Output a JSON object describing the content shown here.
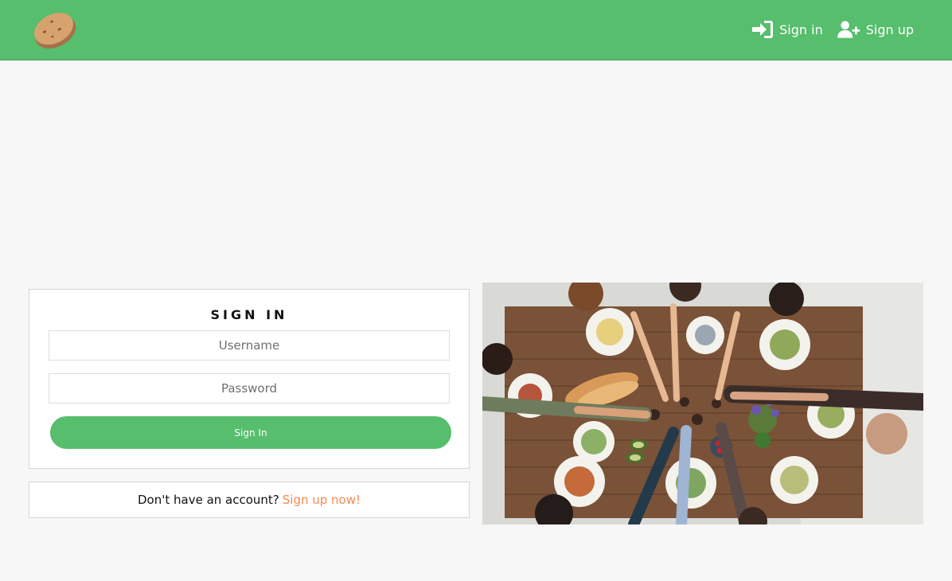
{
  "brand": {
    "logo_icon": "potato-logo-icon"
  },
  "nav": {
    "signin_label": "Sign in",
    "signin_icon": "sign-in-icon",
    "signup_label": "Sign up",
    "signup_icon": "user-plus-icon"
  },
  "signin": {
    "title": "SIGN IN",
    "username_placeholder": "Username",
    "password_placeholder": "Password",
    "button_label": "Sign In"
  },
  "signup_prompt": {
    "text": "Don't have an account?",
    "link": "Sign up now!"
  },
  "colors": {
    "primary": "#56be6c",
    "accent": "#f58a4f",
    "background": "#f7f7f7"
  }
}
